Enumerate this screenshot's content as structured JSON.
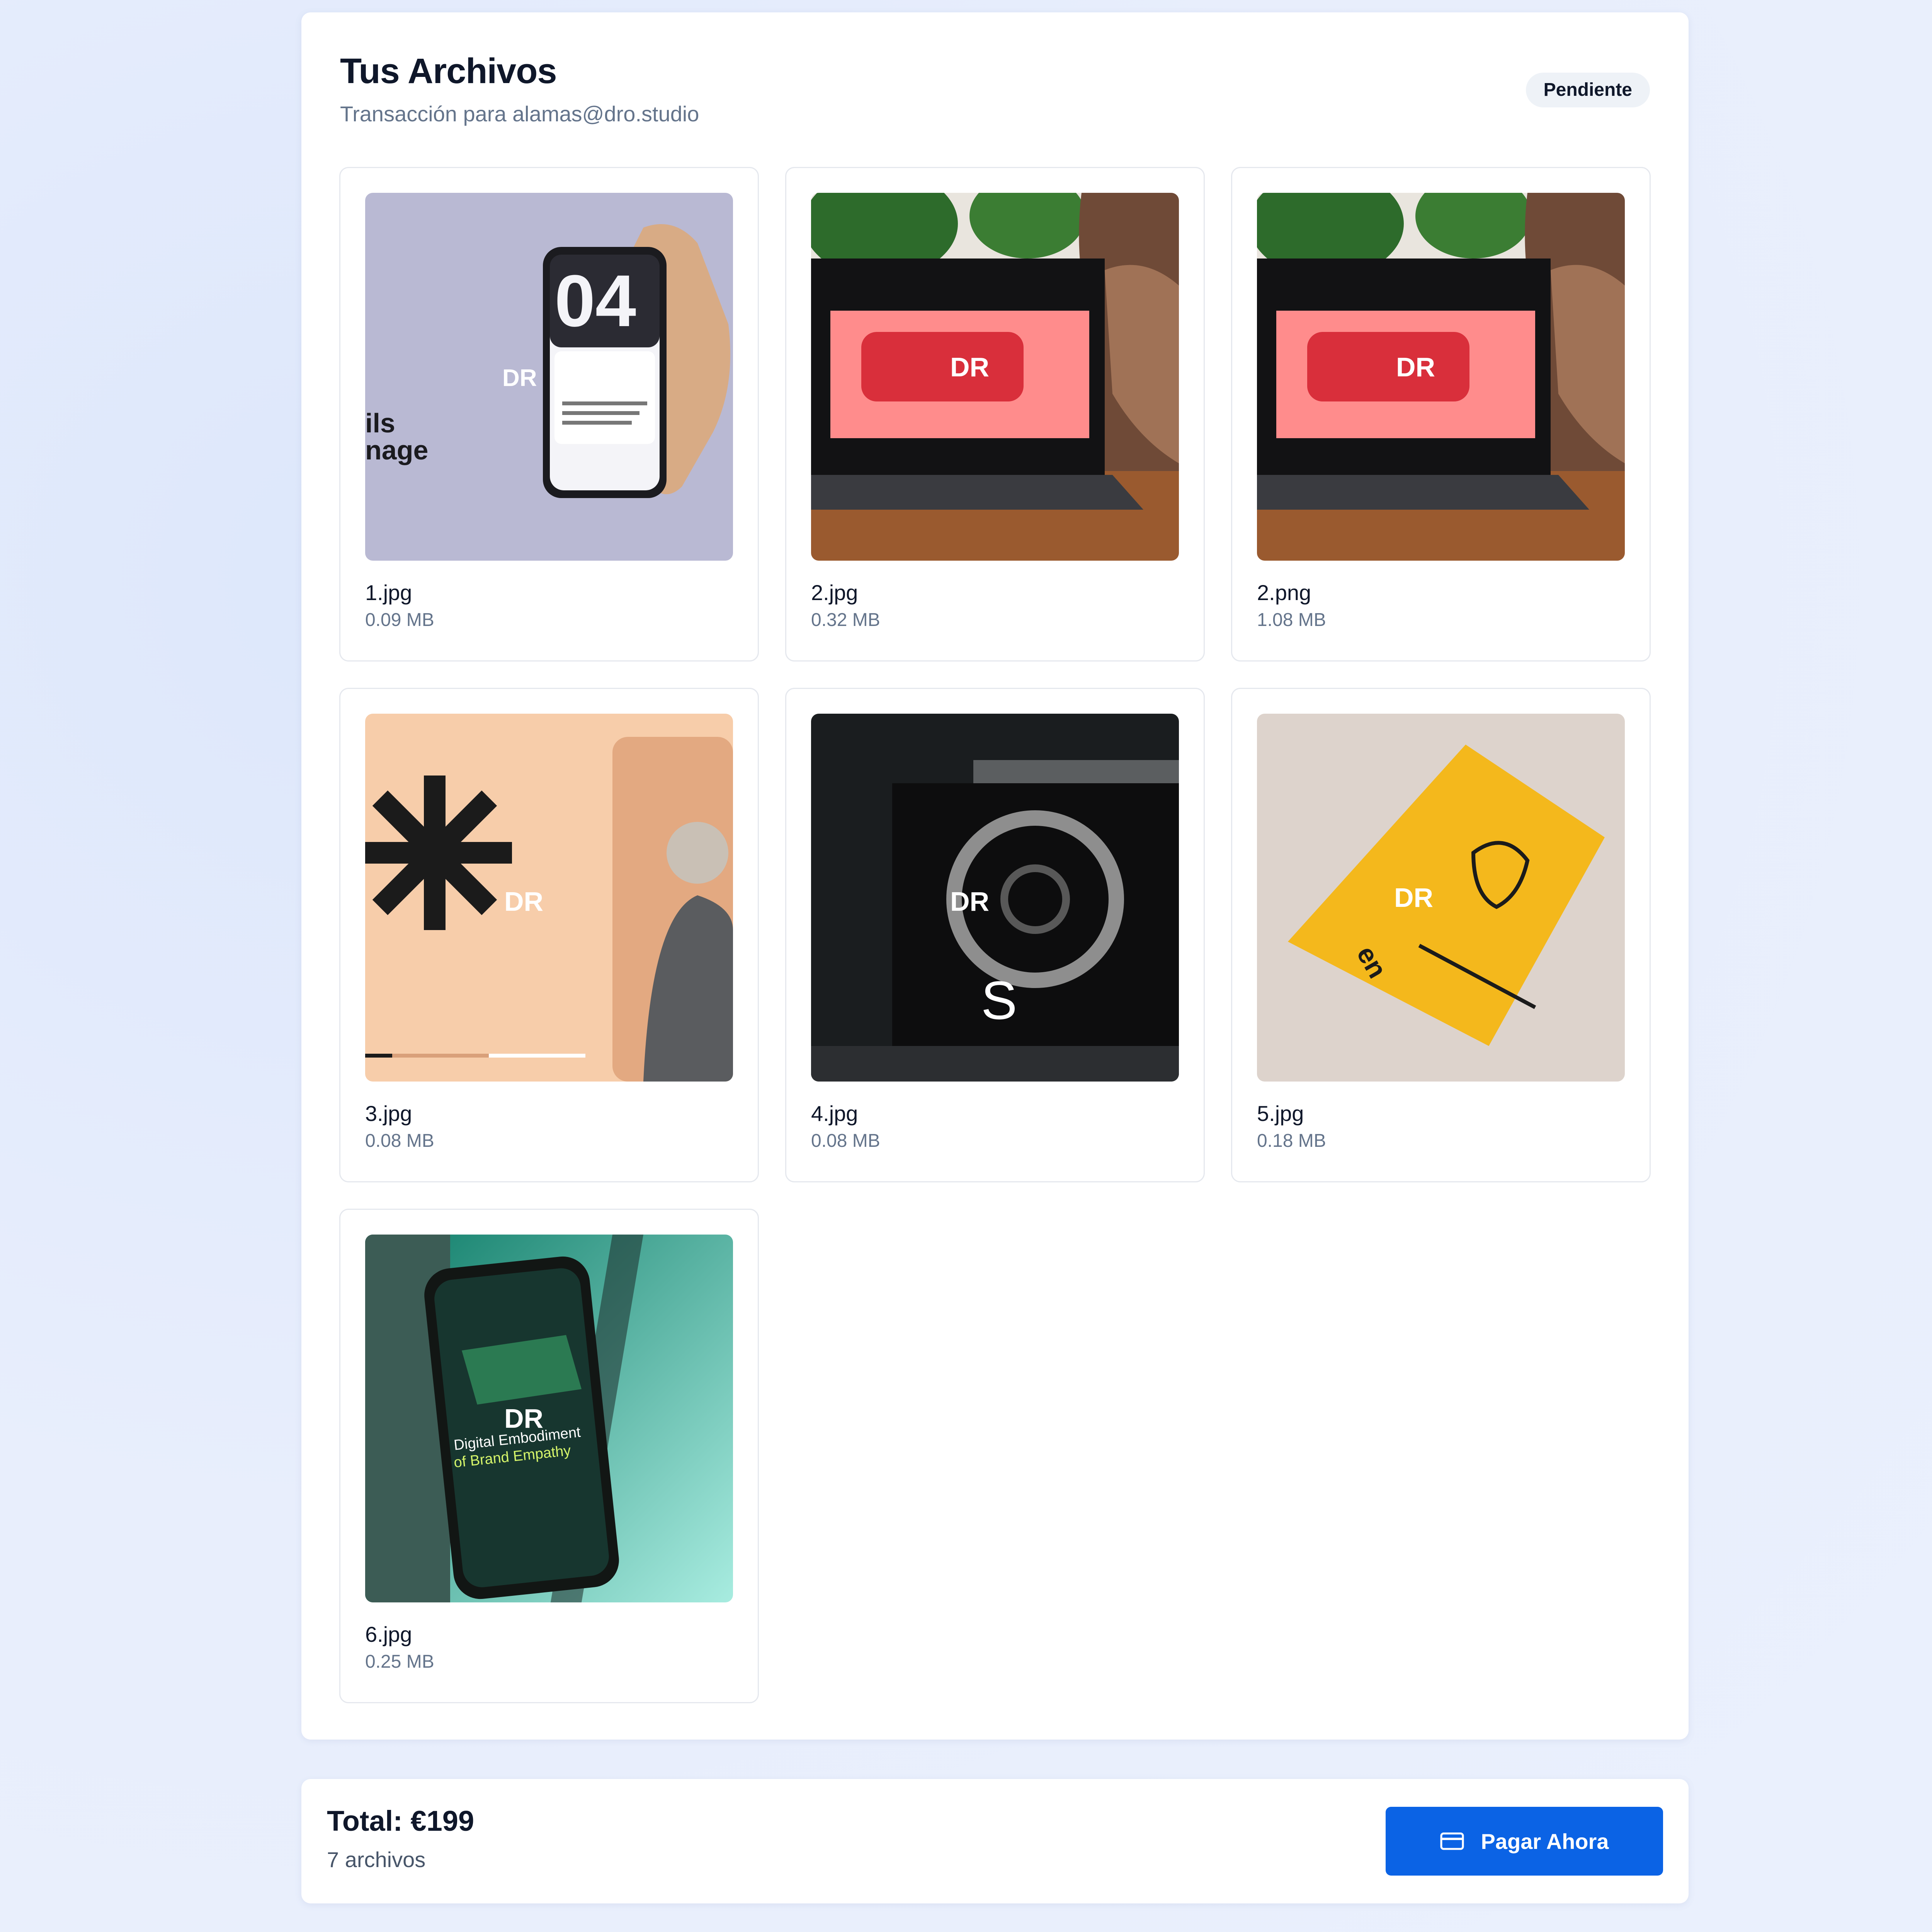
{
  "header": {
    "title": "Tus Archivos",
    "subtitle": "Transacción para alamas@dro.studio",
    "status_badge": "Pendiente"
  },
  "files": [
    {
      "name": "1.jpg",
      "size": "0.09 MB",
      "thumbnail": "phone-in-hand-mockup"
    },
    {
      "name": "2.jpg",
      "size": "0.32 MB",
      "thumbnail": "laptop-red-sofa-dog"
    },
    {
      "name": "2.png",
      "size": "1.08 MB",
      "thumbnail": "laptop-red-sofa-dog"
    },
    {
      "name": "3.jpg",
      "size": "0.08 MB",
      "thumbnail": "peach-asterisk-portrait"
    },
    {
      "name": "4.jpg",
      "size": "0.08 MB",
      "thumbnail": "dark-laptop-torus"
    },
    {
      "name": "5.jpg",
      "size": "0.18 MB",
      "thumbnail": "yellow-card-on-fabric"
    },
    {
      "name": "6.jpg",
      "size": "0.25 MB",
      "thumbnail": "teal-phone-mockup"
    }
  ],
  "footer": {
    "total": "Total: €199",
    "file_count": "7 archivos",
    "pay_button": "Pagar Ahora",
    "pay_icon": "credit-card-icon"
  },
  "colors": {
    "page_background": "#e7eefc",
    "accent": "#0b63e5",
    "badge_background": "#eef2f7"
  }
}
